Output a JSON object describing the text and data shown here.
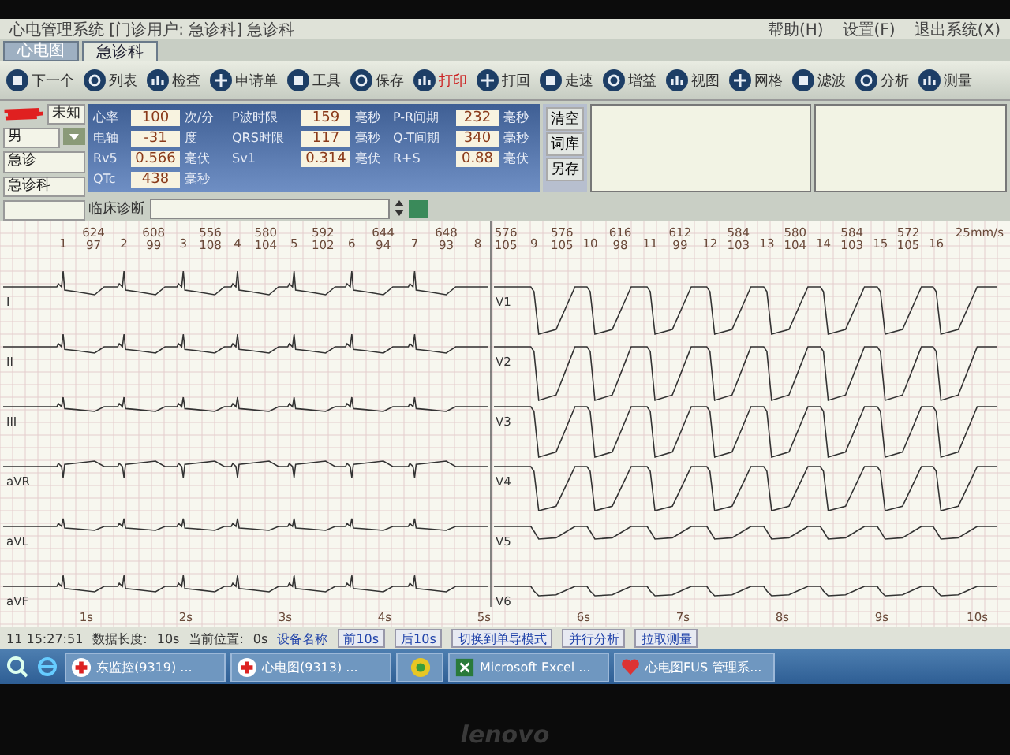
{
  "window": {
    "title": "心电管理系统 [门诊用户: 急诊科] 急诊科",
    "menu": [
      "帮助(H)",
      "设置(F)",
      "退出系统(X)"
    ]
  },
  "tabs": [
    {
      "label": "心电图",
      "selected": false
    },
    {
      "label": "急诊科",
      "selected": true
    }
  ],
  "toolbar": [
    "下一个",
    "列表",
    "检查",
    "申请单",
    "工具",
    "保存",
    "打印",
    "打回",
    "走速",
    "增益",
    "视图",
    "网格",
    "滤波",
    "分析",
    "测量"
  ],
  "patient": {
    "gender": "未知",
    "field_2": "男",
    "field_3": "急诊",
    "department": "急诊科"
  },
  "measurements": [
    {
      "label": "心率",
      "value": "100",
      "unit": "次/分"
    },
    {
      "label": "P波时限",
      "value": "159",
      "unit": "毫秒"
    },
    {
      "label": "P-R间期",
      "value": "232",
      "unit": "毫秒"
    },
    {
      "label": "电轴",
      "value": "-31",
      "unit": "度"
    },
    {
      "label": "QRS时限",
      "value": "117",
      "unit": "毫秒"
    },
    {
      "label": "Q-T间期",
      "value": "340",
      "unit": "毫秒"
    },
    {
      "label": "Rv5",
      "value": "0.566",
      "unit": "毫伏"
    },
    {
      "label": "Sv1",
      "value": "0.314",
      "unit": "毫伏"
    },
    {
      "label": "R+S",
      "value": "0.88",
      "unit": "毫伏"
    },
    {
      "label": "QTc",
      "value": "438",
      "unit": "毫秒"
    }
  ],
  "side_buttons": [
    "清空",
    "词库",
    "另存"
  ],
  "diagnosis": {
    "label": "临床诊断"
  },
  "beats": [
    {
      "n": "1"
    },
    {
      "n": "2",
      "rr": "624",
      "hr": "97"
    },
    {
      "n": "3",
      "rr": "608",
      "hr": "99"
    },
    {
      "n": "4",
      "rr": "556",
      "hr": "108"
    },
    {
      "n": "5",
      "rr": "580",
      "hr": "104"
    },
    {
      "n": "6",
      "rr": "592",
      "hr": "102"
    },
    {
      "n": "7",
      "rr": "644",
      "hr": "94"
    },
    {
      "n": "8",
      "rr": "648",
      "hr": "93"
    },
    {
      "n": "9",
      "rr": "576",
      "hr": "105"
    },
    {
      "n": "10",
      "rr": "576",
      "hr": "105"
    },
    {
      "n": "11",
      "rr": "616",
      "hr": "98"
    },
    {
      "n": "12",
      "rr": "612",
      "hr": "99"
    },
    {
      "n": "13",
      "rr": "584",
      "hr": "103"
    },
    {
      "n": "14",
      "rr": "580",
      "hr": "104"
    },
    {
      "n": "15",
      "rr": "584",
      "hr": "103"
    },
    {
      "n": "16",
      "rr": "572",
      "hr": "105"
    }
  ],
  "speed": "25mm/s",
  "leads": [
    "I",
    "II",
    "III",
    "aVR",
    "aVL",
    "aVF",
    "V1",
    "V2",
    "V3",
    "V4",
    "V5",
    "V6"
  ],
  "time_ticks": [
    "1s",
    "2s",
    "3s",
    "4s",
    "5s",
    "6s",
    "7s",
    "8s",
    "9s",
    "10s"
  ],
  "status_bar": {
    "time": "11 15:27:51",
    "length_label": "数据长度:",
    "length": "10s",
    "position_label": "当前位置:",
    "position": "0s",
    "device_label": "设备名称",
    "buttons": [
      "前10s",
      "后10s",
      "切换到单导模式",
      "并行分析",
      "拉取测量"
    ]
  },
  "taskbar": [
    {
      "label": "东监控(9319) ...",
      "kind": "cross"
    },
    {
      "label": "心电图(9313) ...",
      "kind": "cross"
    },
    {
      "kind": "ball"
    },
    {
      "label": "Microsoft Excel ...",
      "kind": "excel"
    },
    {
      "label": "心电图FUS 管理系...",
      "kind": "heart"
    }
  ],
  "bezel_logo": "lenovo"
}
